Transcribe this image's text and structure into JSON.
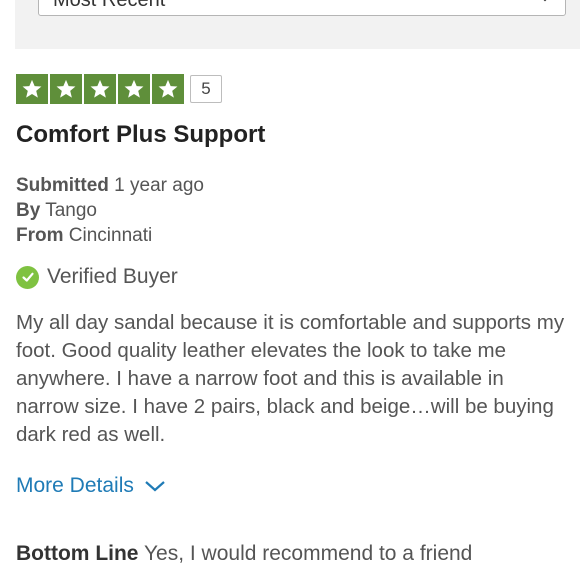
{
  "sort": {
    "selected": "Most Recent"
  },
  "review": {
    "rating": {
      "value": 5,
      "max": 5,
      "label": "5",
      "star_color": "#5f8f3a"
    },
    "title": "Comfort Plus Support",
    "submitted": {
      "label": "Submitted",
      "value": "1 year ago"
    },
    "by": {
      "label": "By",
      "value": "Tango"
    },
    "from": {
      "label": "From",
      "value": "Cincinnati"
    },
    "verified": {
      "label": "Verified Buyer",
      "color": "#7fc241",
      "icon": "checkmark-circle-icon"
    },
    "body": "My all day sandal because it is comfortable and supports my foot. Good quality leather elevates the look to take me anywhere. I have a narrow foot and this is available in narrow size. I have 2 pairs, black and beige…will be buying dark red as well.",
    "more_details": {
      "label": "More Details",
      "color": "#1f7bb6",
      "icon": "chevron-down-icon"
    },
    "bottom_line": {
      "label": "Bottom Line",
      "value": "Yes, I would recommend to a friend"
    }
  }
}
